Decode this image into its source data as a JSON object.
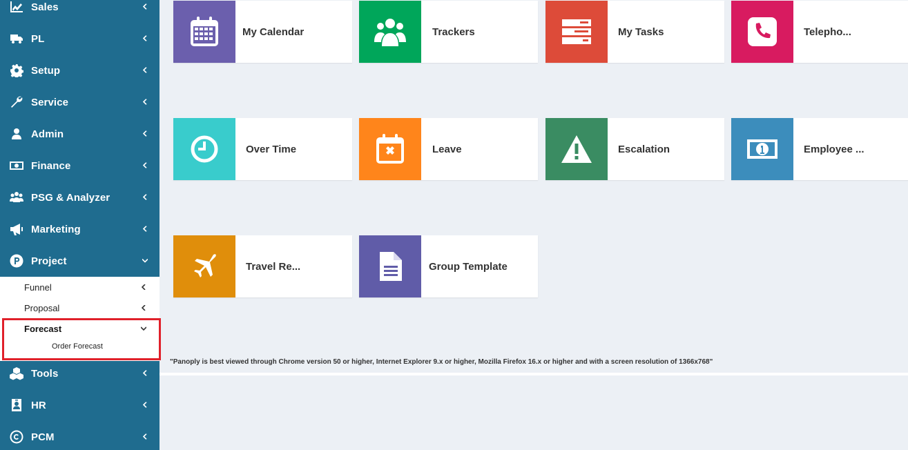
{
  "sidebar": {
    "items": [
      {
        "label": "Sales",
        "icon": "chart-line-icon"
      },
      {
        "label": "PL",
        "icon": "truck-icon"
      },
      {
        "label": "Setup",
        "icon": "gear-icon"
      },
      {
        "label": "Service",
        "icon": "wrench-icon"
      },
      {
        "label": "Admin",
        "icon": "user-icon"
      },
      {
        "label": "Finance",
        "icon": "money-icon"
      },
      {
        "label": "PSG & Analyzer",
        "icon": "users-icon"
      },
      {
        "label": "Marketing",
        "icon": "megaphone-icon"
      },
      {
        "label": "Project",
        "icon": "p-circle-icon"
      },
      {
        "label": "Tools",
        "icon": "cubes-icon"
      },
      {
        "label": "HR",
        "icon": "id-badge-icon"
      },
      {
        "label": "PCM",
        "icon": "copyright-icon"
      }
    ],
    "project_submenu": [
      {
        "label": "Funnel"
      },
      {
        "label": "Proposal"
      },
      {
        "label": "Forecast"
      }
    ],
    "forecast_submenu": [
      {
        "label": "Order Forecast"
      }
    ]
  },
  "tiles": [
    {
      "label": "My Calendar",
      "color": "#6b5fad",
      "icon": "calendar-icon"
    },
    {
      "label": "Trackers",
      "color": "#00a65a",
      "icon": "users-group-icon"
    },
    {
      "label": "My Tasks",
      "color": "#dd4b39",
      "icon": "tasks-icon"
    },
    {
      "label": "Telepho...",
      "color": "#d81b60",
      "icon": "phone-icon"
    },
    {
      "label": "Over Time",
      "color": "#39cccc",
      "icon": "clock-icon"
    },
    {
      "label": "Leave",
      "color": "#ff851b",
      "icon": "calendar-x-icon"
    },
    {
      "label": "Escalation",
      "color": "#3a8c62",
      "icon": "warning-icon"
    },
    {
      "label": "Employee ...",
      "color": "#3c8dbc",
      "icon": "money-bill-icon"
    },
    {
      "label": "Travel Re...",
      "color": "#e08e0b",
      "icon": "plane-icon"
    },
    {
      "label": "Group Template",
      "color": "#605ca8",
      "icon": "document-icon"
    }
  ],
  "footer_notice": "\"Panoply is best viewed through Chrome version 50 or higher, Internet Explorer 9.x or higher, Mozilla Firefox 16.x or higher and with a screen resolution of 1366x768\"",
  "colors": {
    "sidebar_bg": "#1f6c8f",
    "content_bg": "#ecf0f5",
    "highlight": "#e0202a"
  }
}
